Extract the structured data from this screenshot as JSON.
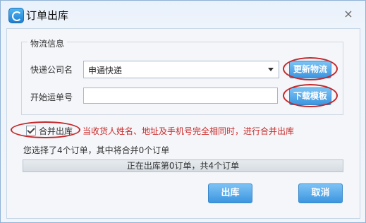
{
  "window": {
    "title": "订单出库",
    "close_symbol": "×"
  },
  "logistics": {
    "group_title": "物流信息",
    "courier_label": "快递公司名",
    "courier_value": "申通快递",
    "start_no_label": "开始运单号",
    "start_no_value": "",
    "update_button": "更新物流",
    "download_button": "下载模板"
  },
  "merge": {
    "checkbox_label": "合并出库",
    "checked": true,
    "hint": "当收货人姓名、地址及手机号完全相同时，进行合并出库"
  },
  "summary": "您选择了4个订单，其中将合并0个订单",
  "progress": {
    "text": "正在出库第0订单，共4个订单",
    "fraction": 0
  },
  "buttons": {
    "ship": "出库",
    "cancel": "取消"
  },
  "colors": {
    "accent": "#3c96e0",
    "highlight_ring": "#c4282b",
    "hint_text": "#cc2a2a"
  }
}
